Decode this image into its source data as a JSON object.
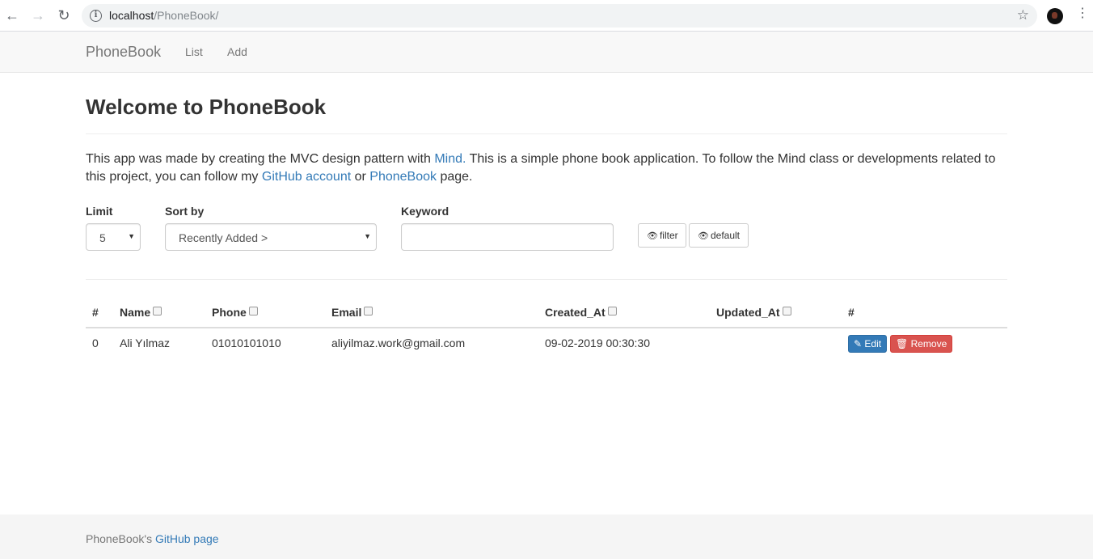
{
  "browser": {
    "url_host": "localhost",
    "url_path": "/PhoneBook/"
  },
  "navbar": {
    "brand": "PhoneBook",
    "links": [
      "List",
      "Add"
    ]
  },
  "main": {
    "title": "Welcome to PhoneBook",
    "intro": {
      "t1": "This app was made by creating the MVC design pattern with ",
      "link_mind": "Mind.",
      "t2": " This is a simple phone book application. To follow the Mind class or developments related to this project, you can follow my ",
      "link_github": "GitHub account",
      "t3": " or ",
      "link_phonebook": "PhoneBook",
      "t4": " page."
    }
  },
  "filters": {
    "limit_label": "Limit",
    "limit_value": "5",
    "sort_label": "Sort by",
    "sort_value": "Recently Added >",
    "keyword_label": "Keyword",
    "keyword_value": "",
    "filter_button": "filter",
    "default_button": "default"
  },
  "table": {
    "headers": [
      "#",
      "Name",
      "Phone",
      "Email",
      "Created_At",
      "Updated_At",
      "#"
    ],
    "rows": [
      {
        "index": "0",
        "name": "Ali Yılmaz",
        "phone": "01010101010",
        "email": "aliyilmaz.work@gmail.com",
        "created_at": "09-02-2019 00:30:30",
        "updated_at": ""
      }
    ],
    "edit_label": "Edit",
    "remove_label": "Remove"
  },
  "footer": {
    "text": "PhoneBook's ",
    "link": "GitHub page"
  },
  "colors": {
    "link": "#337ab7",
    "primary": "#337ab7",
    "danger": "#d9534f"
  }
}
